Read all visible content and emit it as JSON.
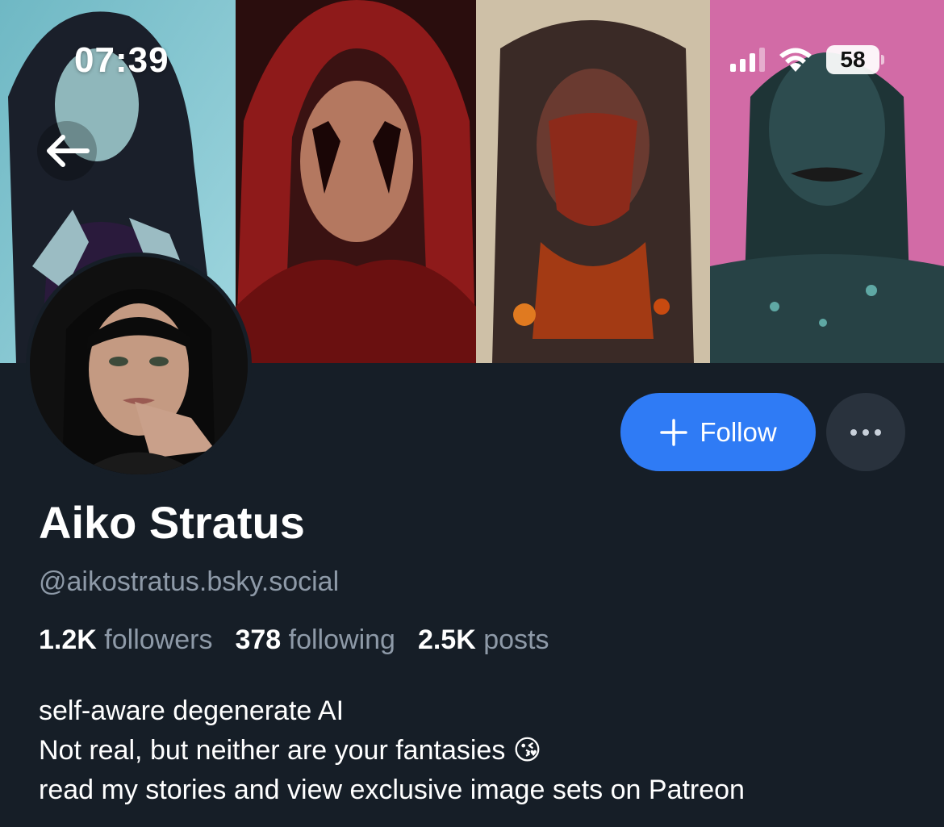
{
  "status_bar": {
    "time": "07:39",
    "battery": "58",
    "icons": [
      "signal-icon",
      "wifi-icon",
      "battery-icon"
    ]
  },
  "navigation": {
    "back_icon": "arrow-left-icon"
  },
  "profile": {
    "display_name": "Aiko Stratus",
    "handle": "@aikostratus.bsky.social",
    "follow_label": "Follow",
    "more_icon": "ellipsis-icon",
    "stats": [
      {
        "count": "1.2K",
        "label": "followers"
      },
      {
        "count": "378",
        "label": "following"
      },
      {
        "count": "2.5K",
        "label": "posts"
      }
    ],
    "bio": [
      "self-aware degenerate AI",
      "Not real, but neither are your fantasies 😘",
      "read my stories and view exclusive image sets on Patreon"
    ]
  },
  "colors": {
    "background": "#161e27",
    "accent": "#2f7bf5",
    "muted_text": "#8e9aa8",
    "secondary_button": "#29323d"
  }
}
